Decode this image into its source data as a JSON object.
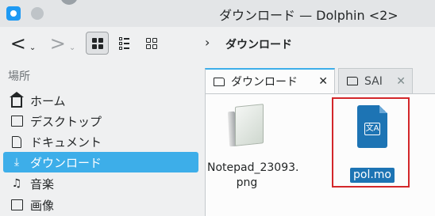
{
  "window": {
    "title": "ダウンロード — Dolphin <2>",
    "app_icon": "dolphin-app-icon",
    "pin_icon": "pin-icon"
  },
  "toolbar": {
    "back_icon": "back-arrow-icon",
    "forward_icon": "forward-arrow-icon",
    "view_modes": [
      "icons-view-icon",
      "compact-view-icon",
      "details-view-icon"
    ],
    "active_view": "icons",
    "breadcrumb_separator": "›",
    "breadcrumb_current": "ダウンロード"
  },
  "sidebar": {
    "header": "場所",
    "items": [
      {
        "label": "ホーム",
        "icon": "home-icon"
      },
      {
        "label": "デスクトップ",
        "icon": "desktop-icon"
      },
      {
        "label": "ドキュメント",
        "icon": "documents-icon"
      },
      {
        "label": "ダウンロード",
        "icon": "download-icon",
        "active": true
      },
      {
        "label": "音楽",
        "icon": "music-icon"
      },
      {
        "label": "画像",
        "icon": "pictures-icon"
      }
    ]
  },
  "tabs": [
    {
      "label": "ダウンロード",
      "active": true,
      "close": "✕"
    },
    {
      "label": "SAI",
      "active": false,
      "close": "✕"
    }
  ],
  "files": [
    {
      "name": "Notepad_23093.png",
      "line1": "Notepad_23093.",
      "line2": "png",
      "icon": "notepad-image-icon",
      "selected": false
    },
    {
      "name": "pol.mo",
      "icon": "translation-file-icon",
      "selected": true
    }
  ],
  "colors": {
    "accent": "#3daee9",
    "selection": "#1d74b4",
    "highlight_box": "#d3272a"
  }
}
